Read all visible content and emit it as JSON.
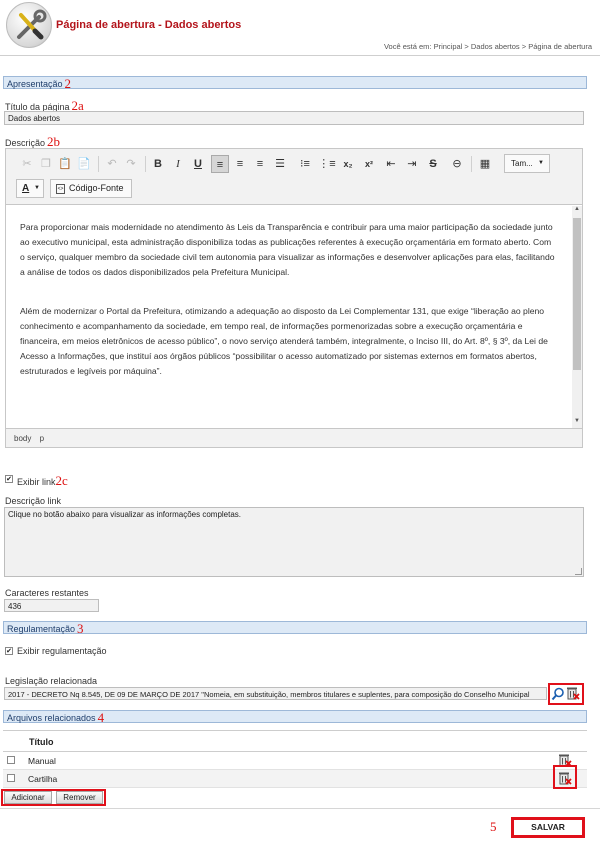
{
  "header": {
    "title": "Página de abertura - Dados abertos",
    "breadcrumb": "Você está em: Principal > Dados abertos > Página de abertura",
    "logo_icon": "tools-icon"
  },
  "annotations": {
    "apresentacao": "2",
    "titulo": "2a",
    "descricao": "2b",
    "exibir_link": "2c",
    "regulamentacao": "3",
    "arquivos": "4",
    "salvar": "5"
  },
  "apresentacao": {
    "section_label": "Apresentação",
    "titulo_label": "Título da página",
    "titulo_value": "Dados abertos",
    "descricao_label": "Descrição"
  },
  "editor": {
    "font_size_label": "Tam...",
    "text_color_label": "A",
    "source_button_label": "Código-Fonte",
    "paragraphs": [
      "Para proporcionar mais modernidade no atendimento às Leis da Transparência e contribuir para uma maior participação da sociedade junto ao executivo municipal, esta administração disponibiliza todas as publicações referentes à execução orçamentária em formato aberto. Com o serviço, qualquer membro da sociedade civil tem autonomia para visualizar as informações e desenvolver aplicações para elas, facilitando a análise de todos os dados disponibilizados pela Prefeitura Municipal.",
      "Além de modernizar o Portal da Prefeitura, otimizando a adequação ao disposto da Lei Complementar 131, que exige “liberação ao pleno conhecimento e acompanhamento da sociedade, em tempo real, de informações pormenorizadas sobre a execução orçamentária e financeira, em meios eletrônicos de acesso público”, o novo serviço atenderá também, integralmente, o Inciso III, do Art. 8º, § 3º, da Lei de Acesso a Informações, que instituí aos órgãos públicos “possibilitar o acesso automatizado por sistemas externos em formatos abertos, estruturados e legíveis por máquina”."
    ],
    "status_path": "body  p",
    "toolbar_icons": [
      "cut-icon",
      "copy-icon",
      "paste-icon",
      "paste-text-icon",
      "undo-icon",
      "redo-icon",
      "bold-icon",
      "italic-icon",
      "underline-icon",
      "align-left-icon",
      "align-center-icon",
      "align-right-icon",
      "justify-icon",
      "bullet-list-icon",
      "numbered-list-icon",
      "subscript-icon",
      "superscript-icon",
      "outdent-icon",
      "indent-icon",
      "strikethrough-icon",
      "link-icon",
      "table-icon"
    ]
  },
  "link": {
    "exibir_label": "Exibir link",
    "exibir_checked": true,
    "descricao_label": "Descrição link",
    "descricao_value": "Clique no botão abaixo para visualizar as informações completas.",
    "restantes_label": "Caracteres restantes",
    "restantes_value": "436"
  },
  "regulamentacao": {
    "section_label": "Regulamentação",
    "exibir_label": "Exibir regulamentação",
    "exibir_checked": true,
    "legislacao_label": "Legislação relacionada",
    "legislacao_value": "2017 - DECRETO Nq 8.545, DE 09 DE MARÇO DE 2017 \"Nomeia, em substituição, membros titulares e suplentes, para composição do Conselho Municipal"
  },
  "arquivos": {
    "section_label": "Arquivos relacionados",
    "column_title": "Título",
    "rows": [
      {
        "title": "Manual"
      },
      {
        "title": "Cartilha"
      }
    ],
    "add_label": "Adicionar",
    "remove_label": "Remover"
  },
  "actions": {
    "save_label": "SALVAR"
  },
  "colors": {
    "accent_red": "#b3141b",
    "section_bg": "#dde9f6",
    "highlight_box": "#e0101a"
  }
}
